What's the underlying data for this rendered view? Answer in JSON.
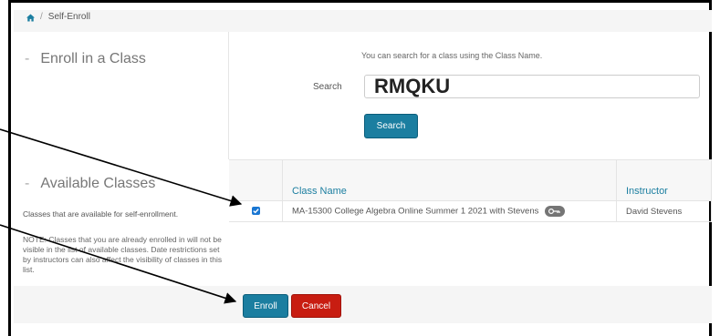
{
  "breadcrumb": {
    "home_icon": "home-icon",
    "separator": "/",
    "current": "Self-Enroll"
  },
  "enroll": {
    "title": "Enroll in a Class",
    "dash": "-",
    "hint": "You can search for a class using the Class Name.",
    "search_label": "Search",
    "search_value": "RMQKU",
    "search_button": "Search"
  },
  "available": {
    "title": "Available Classes",
    "dash": "-",
    "description": "Classes that are available for self-enrollment.",
    "note": "NOTE: Classes that you are already enrolled in will not be visible in the list of available classes. Date restrictions set by instructors can also affect the visibility of classes in this list."
  },
  "table": {
    "columns": [
      "",
      "Class Name",
      "Instructor"
    ],
    "rows": [
      {
        "checked": true,
        "class_name": "MA-15300 College Algebra Online Summer 1 2021 with Stevens",
        "key_icon": "key-icon",
        "instructor": "David Stevens"
      }
    ]
  },
  "footer": {
    "enroll_button": "Enroll",
    "cancel_button": "Cancel"
  },
  "colors": {
    "primary": "#1b7ea0",
    "danger": "#c81d11",
    "checkbox": "#1976d2",
    "header_text": "#1b7ea0"
  }
}
